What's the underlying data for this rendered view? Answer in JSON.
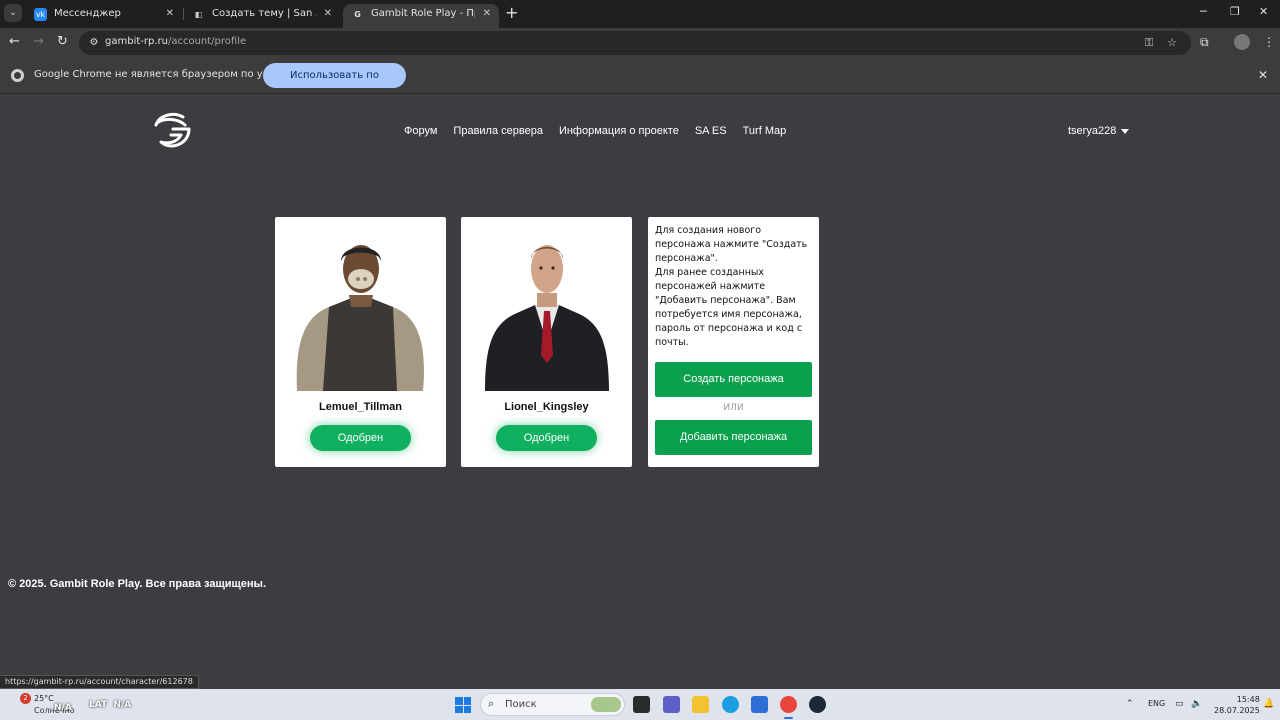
{
  "browser": {
    "tabs": [
      {
        "title": "Мессенджер",
        "favicon": "vk-icon",
        "color": "#2787f5",
        "active": false
      },
      {
        "title": "Создать тему | San Andreas Em",
        "favicon": "forum-icon",
        "color": "#555555",
        "active": false
      },
      {
        "title": "Gambit Role Play - Профиль Ui",
        "favicon": "gambit-icon",
        "color": "#3c3c3c",
        "active": true
      }
    ],
    "url_host": "gambit-rp.ru",
    "url_path": "/account/profile"
  },
  "infobar": {
    "message": "Google Chrome не является браузером по умолчанию.",
    "button_label": "Использовать по умолчанию"
  },
  "site": {
    "nav": [
      "Форум",
      "Правила сервера",
      "Информация о проекте",
      "SA ES",
      "Turf Map"
    ],
    "username": "tserya228",
    "characters": [
      {
        "name": "Lemuel_Tillman",
        "status": "Одобрен"
      },
      {
        "name": "Lionel_Kingsley",
        "status": "Одобрен"
      }
    ],
    "info_card": {
      "text_create": "Для создания нового персонажа нажмите \"Создать персонажа\".",
      "text_add": "Для ранее созданных персонажей нажмите \"Добавить персонажа\". Вам потребуется имя персонажа, пароль от персонажа и код с почты.",
      "create_button": "Создать персонажа",
      "or_text": "ИЛИ",
      "add_button": "Добавить персонажа"
    },
    "footer": "© 2025. Gambit Role Play. Все права защищены.",
    "accent_color": "#0aa04d"
  },
  "status_bar_url": "https://gambit-rp.ru/account/character/612678",
  "taskbar": {
    "weather_badge": "2",
    "weather_temp": "25°C",
    "weather_condition": "Солнечно",
    "overlay_left": "N/A",
    "overlay_lat_label": "LAT",
    "overlay_lat_value": "N/A",
    "search_placeholder": "Поиск",
    "language": "ENG",
    "time": "15:48",
    "date": "28.07.2025"
  }
}
